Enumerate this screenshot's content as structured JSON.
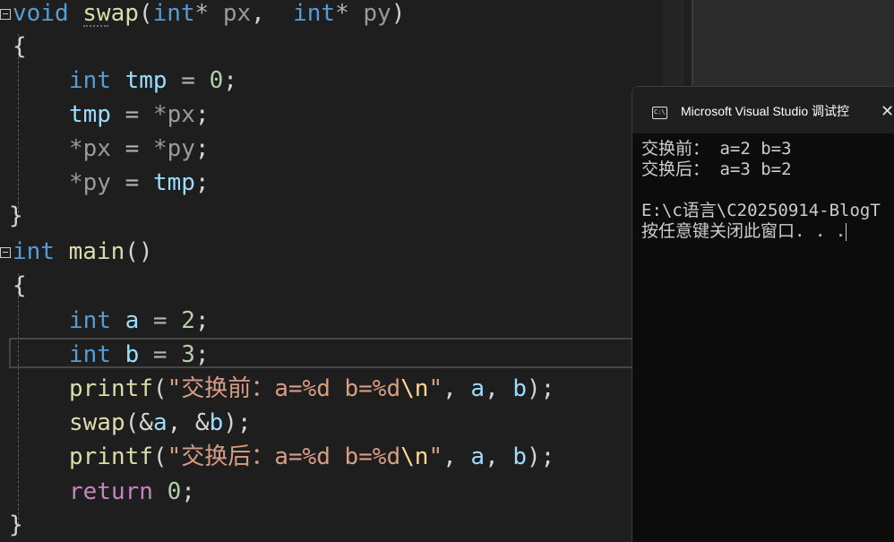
{
  "editor": {
    "code_lines": [
      {
        "tokens": [
          "void",
          " ",
          "swap",
          "(",
          "int",
          "*",
          " px",
          ",",
          "  ",
          "int",
          "*",
          " py",
          ")"
        ]
      },
      {
        "text": "{"
      },
      {
        "tokens": [
          "int",
          " tmp",
          " = ",
          "0",
          ";"
        ]
      },
      {
        "tokens": [
          "tmp",
          " = ",
          "*px",
          ";"
        ]
      },
      {
        "tokens": [
          "*px",
          " = ",
          "*py",
          ";"
        ]
      },
      {
        "tokens": [
          "*py",
          " = ",
          "tmp",
          ";"
        ]
      },
      {
        "text": "}"
      },
      {
        "tokens": [
          "int",
          " ",
          "main",
          "()"
        ]
      },
      {
        "text": "{"
      },
      {
        "tokens": [
          "int",
          " a",
          " = ",
          "2",
          ";"
        ]
      },
      {
        "tokens": [
          "int",
          " b",
          " = ",
          "3",
          ";"
        ]
      },
      {
        "tokens": [
          "printf",
          "(",
          "\"交换前：a=%d b=%d",
          "\\n",
          "\"",
          ",",
          " a",
          ",",
          " b",
          ");"
        ]
      },
      {
        "tokens": [
          "swap",
          "(&",
          "a",
          ",",
          " &",
          "b",
          ");"
        ]
      },
      {
        "tokens": [
          "printf",
          "(",
          "\"交换后：a=%d b=%d",
          "\\n",
          "\"",
          ",",
          " a",
          ",",
          " b",
          ");"
        ]
      },
      {
        "tokens": [
          "return",
          " ",
          "0",
          ";"
        ]
      },
      {
        "text": "}"
      }
    ]
  },
  "console": {
    "title": "Microsoft Visual Studio 调试控",
    "icon": "console-app-icon",
    "icon_text": "C:\\",
    "close_label": "✕",
    "output": [
      "交换前： a=2 b=3",
      "交换后： a=3 b=2",
      "",
      "E:\\c语言\\C20250914-BlogT",
      "按任意键关闭此窗口. . ."
    ]
  },
  "colors": {
    "keyword": "#569cd6",
    "control_keyword": "#c586c0",
    "function": "#dcdcaa",
    "variable": "#9cdcfe",
    "parameter": "#9a9a9a",
    "number": "#b5cea8",
    "string": "#d69d85",
    "escape": "#ffd68f",
    "editor_bg": "#1e1e1e",
    "console_bg": "#0c0c0c"
  }
}
